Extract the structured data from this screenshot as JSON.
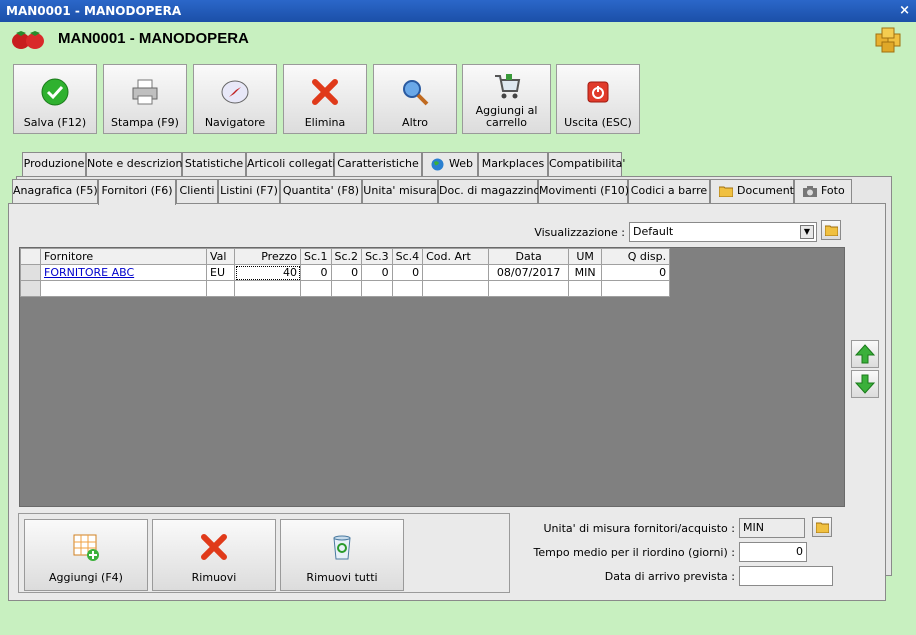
{
  "window": {
    "title": "MAN0001 - MANODOPERA",
    "close_glyph": "×"
  },
  "header": {
    "title": "MAN0001 - MANODOPERA"
  },
  "toolbar": [
    {
      "label": "Salva (F12)",
      "icon": "check-icon"
    },
    {
      "label": "Stampa (F9)",
      "icon": "printer-icon"
    },
    {
      "label": "Navigatore",
      "icon": "compass-icon"
    },
    {
      "label": "Elimina",
      "icon": "x-icon"
    },
    {
      "label": "Altro",
      "icon": "magnifier-icon"
    },
    {
      "label": "Aggiungi al carrello",
      "icon": "cart-icon"
    },
    {
      "label": "Uscita (ESC)",
      "icon": "power-icon"
    }
  ],
  "tabs_back": [
    "Produzione",
    "Note e descrizioni",
    "Statistiche",
    "Articoli collegati",
    "Caratteristiche",
    "Web",
    "Markplaces",
    "Compatibilita'"
  ],
  "tabs_front": [
    "Anagrafica (F5)",
    "Fornitori (F6)",
    "Clienti",
    "Listini (F7)",
    "Quantita' (F8)",
    "Unita' misura",
    "Doc. di magazzino",
    "Movimenti (F10)",
    "Codici a barre",
    "Documenti",
    "Foto"
  ],
  "visualizzazione": {
    "label": "Visualizzazione :",
    "value": "Default"
  },
  "grid": {
    "columns": [
      "",
      "Fornitore",
      "Val",
      "Prezzo",
      "Sc.1",
      "Sc.2",
      "Sc.3",
      "Sc.4",
      "Cod. Art",
      "Data",
      "UM",
      "Q disp."
    ],
    "rows": [
      [
        "",
        "FORNITORE ABC",
        "EU",
        "40",
        "0",
        "0",
        "0",
        "0",
        "",
        "08/07/2017",
        "MIN",
        "0"
      ],
      [
        "",
        "",
        "",
        "",
        "",
        "",
        "",
        "",
        "",
        "",
        "",
        ""
      ]
    ]
  },
  "bottom_buttons": [
    {
      "label": "Aggiungi (F4)",
      "icon": "grid-add-icon"
    },
    {
      "label": "Rimuovi",
      "icon": "x-icon"
    },
    {
      "label": "Rimuovi tutti",
      "icon": "recycle-bin-icon"
    }
  ],
  "fields": {
    "um_label": "Unita' di misura fornitori/acquisto :",
    "um_value": "MIN",
    "tempo_label": "Tempo medio per il riordino (giorni) :",
    "tempo_value": "0",
    "data_label": "Data di arrivo prevista :",
    "data_value": ""
  }
}
